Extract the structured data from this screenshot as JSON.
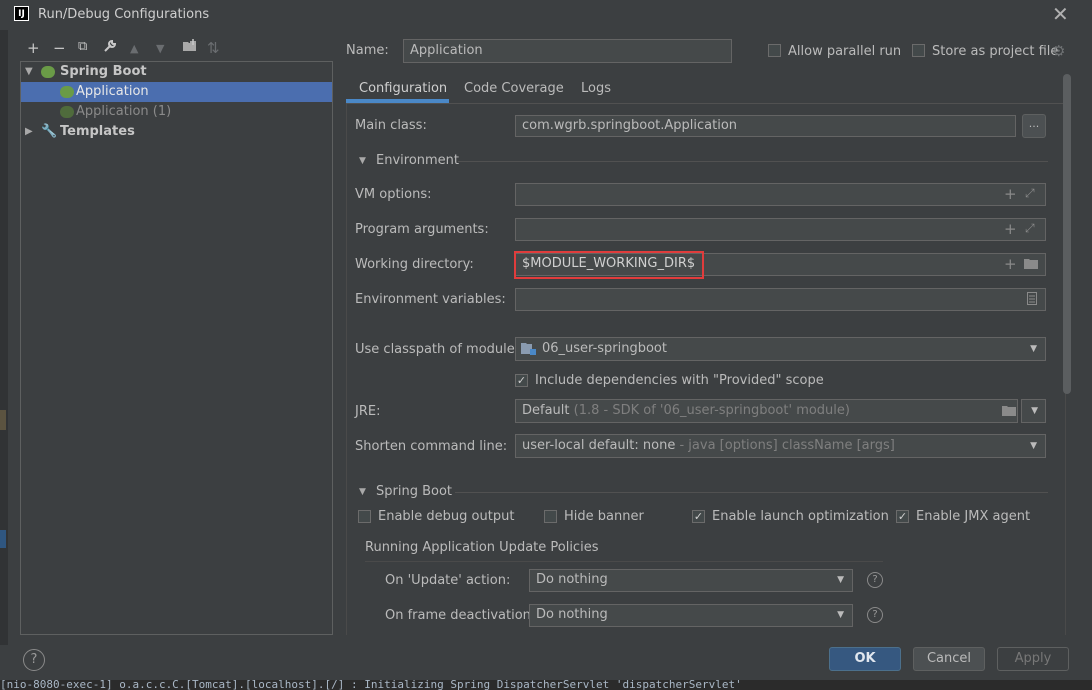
{
  "window": {
    "title": "Run/Debug Configurations",
    "app_icon": "IJ"
  },
  "toolbar": {
    "icons": [
      "add-icon",
      "remove-icon",
      "copy-icon",
      "wrench-icon",
      "move-up-icon",
      "move-down-icon",
      "new-folder-icon",
      "sort-icon"
    ],
    "glyphs": [
      "+",
      "−",
      "⧉",
      "🔧",
      "▲",
      "▼",
      "▣",
      "⇅"
    ]
  },
  "tree": {
    "spring_boot": "Spring Boot",
    "items": [
      {
        "label": "Application",
        "selected": true
      },
      {
        "label": "Application (1)",
        "selected": false
      }
    ],
    "templates": "Templates"
  },
  "header": {
    "name_label": "Name:",
    "name_value": "Application",
    "allow_parallel": "Allow parallel run",
    "store_as_project": "Store as project file"
  },
  "tabs": [
    "Configuration",
    "Code Coverage",
    "Logs"
  ],
  "config": {
    "main_class_label": "Main class:",
    "main_class_value": "com.wgrb.springboot.Application",
    "ellipsis": "...",
    "environment": "Environment",
    "vm_options": "VM options:",
    "program_args": "Program arguments:",
    "working_dir": "Working directory:",
    "working_dir_value": "$MODULE_WORKING_DIR$",
    "env_vars": "Environment variables:",
    "classpath_label": "Use classpath of module:",
    "classpath_value": "06_user-springboot",
    "include_deps": "Include dependencies with \"Provided\" scope",
    "jre_label": "JRE:",
    "jre_value": "Default",
    "jre_hint": "(1.8 - SDK of '06_user-springboot' module)",
    "shorten_label": "Shorten command line:",
    "shorten_value": "user-local default: none",
    "shorten_hint": "- java [options] className [args]"
  },
  "spring_boot": {
    "section": "Spring Boot",
    "enable_debug": "Enable debug output",
    "hide_banner": "Hide banner",
    "launch_opt": "Enable launch optimization",
    "jmx": "Enable JMX agent",
    "policies": "Running Application Update Policies",
    "on_update_label": "On 'Update' action:",
    "on_update_value": "Do nothing",
    "on_frame_label": "On frame deactivation:",
    "on_frame_value": "Do nothing"
  },
  "buttons": {
    "ok": "OK",
    "cancel": "Cancel",
    "apply": "Apply",
    "help": "?"
  },
  "console": {
    "text": "[nio-8080-exec-1] o.a.c.c.C.[Tomcat].[localhost].[/]       : Initializing Spring DispatcherServlet 'dispatcherServlet'"
  },
  "colors": {
    "accent": "#4a88c7",
    "highlight_box": "#e03c3c",
    "selected": "#4b6eaf"
  }
}
